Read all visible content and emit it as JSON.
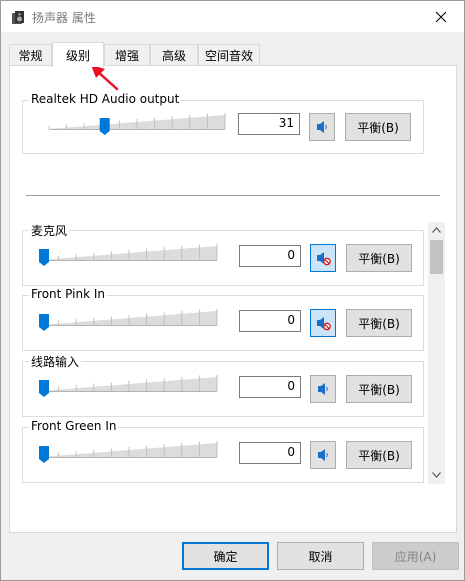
{
  "window": {
    "title": "扬声器 属性",
    "close_icon": "close-icon"
  },
  "tabs": [
    {
      "label": "常规",
      "active": false
    },
    {
      "label": "级别",
      "active": true
    },
    {
      "label": "增强",
      "active": false
    },
    {
      "label": "高级",
      "active": false
    },
    {
      "label": "空间音效",
      "active": false
    }
  ],
  "master": {
    "label": "Realtek HD Audio output",
    "value": "31",
    "level_percent": 31,
    "muted": false,
    "balance_label": "平衡(B)"
  },
  "channels": [
    {
      "label": "麦克风",
      "value": "0",
      "level_percent": 0,
      "muted": true,
      "balance_label": "平衡(B)"
    },
    {
      "label": "Front Pink In",
      "value": "0",
      "level_percent": 0,
      "muted": true,
      "balance_label": "平衡(B)"
    },
    {
      "label": "线路输入",
      "value": "0",
      "level_percent": 0,
      "muted": false,
      "balance_label": "平衡(B)"
    },
    {
      "label": "Front Green In",
      "value": "0",
      "level_percent": 0,
      "muted": false,
      "balance_label": "平衡(B)"
    }
  ],
  "footer": {
    "ok_label": "确定",
    "cancel_label": "取消",
    "apply_label": "应用(A)"
  },
  "colors": {
    "accent": "#0078d7",
    "annotation_arrow": "#e81123"
  }
}
